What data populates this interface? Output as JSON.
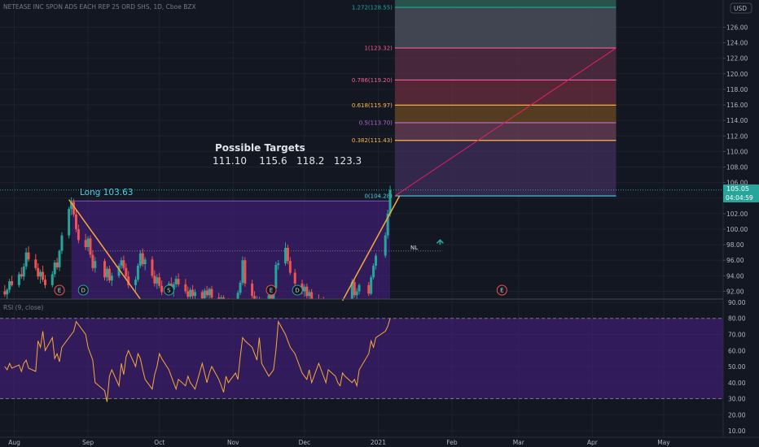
{
  "header": {
    "symbol_title": "NETEASE INC SPON ADS EACH REP 25 ORD SHS, 1D, Cboe BZX"
  },
  "price_axis": {
    "currency_label": "USD",
    "last_price": "105.05",
    "countdown": "04:04:59"
  },
  "annotations": {
    "long_entry": "Long 103.63",
    "targets_title": "Possible Targets",
    "targets_values": "111.10    115.6   118.2   123.3",
    "nl_label": "NL"
  },
  "fib_levels": [
    {
      "label": "1.272(128.55)",
      "price": 128.55,
      "color": "#26a69a"
    },
    {
      "label": "1(123.32)",
      "price": 123.32,
      "color": "#f06292"
    },
    {
      "label": "0.786(119.20)",
      "price": 119.2,
      "color": "#f06292"
    },
    {
      "label": "0.618(115.97)",
      "price": 115.97,
      "color": "#ffb74d"
    },
    {
      "label": "0.5(113.70)",
      "price": 113.7,
      "color": "#ba68c8"
    },
    {
      "label": "0.382(111.43)",
      "price": 111.43,
      "color": "#ffb74d"
    },
    {
      "label": "0(104.28)",
      "price": 104.28,
      "color": "#4dd0e1"
    }
  ],
  "events": [
    {
      "label": "E",
      "date": "2020-08-20"
    },
    {
      "label": "D",
      "date": "2020-08-30"
    },
    {
      "label": "S",
      "date": "2020-10-05"
    },
    {
      "label": "E",
      "date": "2020-11-17"
    },
    {
      "label": "D",
      "date": "2020-11-28"
    },
    {
      "label": "E",
      "date": "2021-02-22"
    }
  ],
  "rsi": {
    "title": "RSI (9, close)",
    "upper": 80,
    "lower": 30
  },
  "colors": {
    "up": "#26a69a",
    "down": "#ef5350",
    "rsi_line": "#f6a93b",
    "fib_line": "#e91e63"
  },
  "chart_data": {
    "type": "candlestick",
    "price_ylim": [
      91,
      129.5
    ],
    "price_ticks": [
      92,
      94,
      96,
      98,
      100,
      102,
      104,
      106,
      108,
      110,
      112,
      114,
      116,
      118,
      120,
      122,
      124,
      126
    ],
    "rsi_ylim": [
      6,
      92
    ],
    "rsi_ticks": [
      10,
      20,
      30,
      40,
      50,
      60,
      70,
      80,
      90
    ],
    "x_range": [
      "2020-07-26",
      "2021-05-26"
    ],
    "x_ticks": [
      {
        "label": "Aug",
        "date": "2020-08-01"
      },
      {
        "label": "Sep",
        "date": "2020-09-01"
      },
      {
        "label": "Oct",
        "date": "2020-10-01"
      },
      {
        "label": "Nov",
        "date": "2020-11-01"
      },
      {
        "label": "Dec",
        "date": "2020-12-01"
      },
      {
        "label": "2021",
        "date": "2021-01-01"
      },
      {
        "label": "Feb",
        "date": "2021-02-01"
      },
      {
        "label": "Mar",
        "date": "2021-03-01"
      },
      {
        "label": "Apr",
        "date": "2021-04-01"
      },
      {
        "label": "May",
        "date": "2021-05-01"
      }
    ],
    "candles": [
      [
        "2020-07-28",
        92.0,
        92.8,
        91.3,
        91.6
      ],
      [
        "2020-07-29",
        91.6,
        92.4,
        91.0,
        92.2
      ],
      [
        "2020-07-30",
        92.2,
        93.6,
        91.8,
        93.3
      ],
      [
        "2020-07-31",
        93.3,
        94.0,
        92.6,
        92.8
      ],
      [
        "2020-08-03",
        92.8,
        94.5,
        92.5,
        94.2
      ],
      [
        "2020-08-04",
        94.2,
        95.1,
        93.6,
        93.9
      ],
      [
        "2020-08-05",
        93.9,
        95.6,
        93.4,
        95.2
      ],
      [
        "2020-08-06",
        95.2,
        97.6,
        94.8,
        97.0
      ],
      [
        "2020-08-07",
        97.0,
        97.8,
        95.8,
        96.1
      ],
      [
        "2020-08-10",
        96.1,
        96.8,
        94.7,
        95.0
      ],
      [
        "2020-08-11",
        95.0,
        95.6,
        93.5,
        93.9
      ],
      [
        "2020-08-12",
        93.9,
        94.8,
        93.0,
        94.5
      ],
      [
        "2020-08-13",
        94.5,
        95.3,
        93.2,
        93.5
      ],
      [
        "2020-08-14",
        93.5,
        94.1,
        92.4,
        92.8
      ],
      [
        "2020-08-17",
        92.8,
        94.6,
        92.5,
        94.2
      ],
      [
        "2020-08-18",
        94.2,
        96.0,
        93.8,
        95.7
      ],
      [
        "2020-08-19",
        95.7,
        96.3,
        94.8,
        95.1
      ],
      [
        "2020-08-20",
        95.1,
        97.4,
        94.6,
        97.2
      ],
      [
        "2020-08-21",
        97.2,
        99.6,
        96.8,
        99.2
      ],
      [
        "2020-08-24",
        99.2,
        102.9,
        98.8,
        102.6
      ],
      [
        "2020-08-25",
        102.6,
        104.1,
        101.8,
        103.5
      ],
      [
        "2020-08-26",
        103.5,
        103.9,
        101.6,
        101.9
      ],
      [
        "2020-08-27",
        101.9,
        102.4,
        99.6,
        100.0
      ],
      [
        "2020-08-28",
        100.0,
        100.6,
        98.2,
        98.6
      ],
      [
        "2020-08-31",
        98.6,
        99.4,
        97.3,
        97.7
      ],
      [
        "2020-09-01",
        97.7,
        99.1,
        97.2,
        98.8
      ],
      [
        "2020-09-02",
        98.8,
        99.2,
        96.3,
        96.7
      ],
      [
        "2020-09-03",
        96.7,
        97.3,
        94.6,
        95.0
      ],
      [
        "2020-09-04",
        95.0,
        96.4,
        94.4,
        95.9
      ],
      [
        "2020-09-08",
        95.9,
        96.2,
        93.4,
        93.8
      ],
      [
        "2020-09-09",
        93.8,
        95.2,
        93.3,
        94.9
      ],
      [
        "2020-09-10",
        94.9,
        95.3,
        93.1,
        93.4
      ],
      [
        "2020-09-11",
        93.4,
        94.4,
        92.7,
        94.0
      ],
      [
        "2020-09-14",
        94.0,
        95.6,
        93.7,
        95.3
      ],
      [
        "2020-09-15",
        95.3,
        96.4,
        94.9,
        96.0
      ],
      [
        "2020-09-16",
        96.0,
        96.6,
        94.7,
        95.0
      ],
      [
        "2020-09-17",
        95.0,
        95.6,
        93.5,
        93.9
      ],
      [
        "2020-09-18",
        93.9,
        94.6,
        92.4,
        92.8
      ],
      [
        "2020-09-21",
        92.8,
        93.9,
        92.0,
        93.5
      ],
      [
        "2020-09-22",
        93.5,
        95.6,
        93.2,
        95.3
      ],
      [
        "2020-09-23",
        95.3,
        97.3,
        95.0,
        96.9
      ],
      [
        "2020-09-24",
        96.9,
        97.5,
        95.2,
        95.5
      ],
      [
        "2020-09-25",
        95.5,
        96.4,
        94.7,
        96.1
      ],
      [
        "2020-09-28",
        96.1,
        96.5,
        93.7,
        94.0
      ],
      [
        "2020-09-29",
        94.0,
        94.7,
        92.6,
        93.0
      ],
      [
        "2020-09-30",
        93.0,
        94.2,
        92.3,
        93.8
      ],
      [
        "2020-10-01",
        93.8,
        94.4,
        92.4,
        92.7
      ],
      [
        "2020-10-02",
        92.7,
        93.4,
        91.5,
        91.9
      ],
      [
        "2020-10-05",
        91.9,
        93.3,
        91.6,
        93.0
      ],
      [
        "2020-10-06",
        93.0,
        93.8,
        91.9,
        92.2
      ],
      [
        "2020-10-07",
        92.2,
        93.2,
        91.3,
        92.9
      ],
      [
        "2020-10-08",
        92.9,
        94.0,
        92.5,
        93.6
      ],
      [
        "2020-10-09",
        93.6,
        94.3,
        92.6,
        92.9
      ],
      [
        "2020-10-12",
        92.9,
        93.6,
        91.7,
        92.0
      ],
      [
        "2020-10-13",
        92.0,
        92.6,
        90.9,
        91.3
      ],
      [
        "2020-10-14",
        91.3,
        92.5,
        90.8,
        92.2
      ],
      [
        "2020-10-15",
        92.2,
        92.8,
        91.0,
        91.4
      ],
      [
        "2020-10-16",
        91.4,
        92.3,
        90.7,
        91.9
      ],
      [
        "2020-10-19",
        91.9,
        92.2,
        90.8,
        91.1
      ],
      [
        "2020-10-20",
        91.1,
        92.4,
        90.9,
        92.1
      ],
      [
        "2020-10-21",
        92.1,
        92.7,
        91.2,
        91.5
      ],
      [
        "2020-10-22",
        91.5,
        92.5,
        91.1,
        92.3
      ],
      [
        "2020-10-23",
        92.3,
        92.7,
        90.9,
        91.2
      ],
      [
        "2020-10-26",
        91.2,
        91.8,
        90.0,
        90.4
      ],
      [
        "2020-10-27",
        90.4,
        91.5,
        90.1,
        91.2
      ],
      [
        "2020-10-28",
        91.2,
        91.5,
        89.6,
        89.9
      ],
      [
        "2020-10-29",
        89.9,
        91.0,
        89.5,
        90.7
      ],
      [
        "2020-10-30",
        90.7,
        91.1,
        89.3,
        89.6
      ],
      [
        "2020-11-02",
        89.6,
        90.9,
        89.2,
        90.5
      ],
      [
        "2020-11-03",
        90.5,
        92.1,
        90.2,
        91.8
      ],
      [
        "2020-11-04",
        91.8,
        93.4,
        91.5,
        93.1
      ],
      [
        "2020-11-05",
        93.1,
        96.5,
        92.8,
        96.0
      ],
      [
        "2020-11-06",
        96.0,
        96.4,
        92.6,
        93.0
      ],
      [
        "2020-11-09",
        93.0,
        93.5,
        91.1,
        91.4
      ],
      [
        "2020-11-10",
        91.4,
        92.0,
        89.9,
        90.3
      ],
      [
        "2020-11-11",
        90.3,
        91.4,
        89.9,
        91.0
      ],
      [
        "2020-11-12",
        91.0,
        91.3,
        89.6,
        89.9
      ],
      [
        "2020-11-13",
        89.9,
        90.9,
        89.5,
        90.6
      ],
      [
        "2020-11-16",
        90.6,
        91.8,
        90.3,
        91.5
      ],
      [
        "2020-11-17",
        91.5,
        92.0,
        90.5,
        90.8
      ],
      [
        "2020-11-18",
        90.8,
        92.7,
        90.6,
        92.4
      ],
      [
        "2020-11-19",
        92.4,
        95.8,
        92.1,
        95.4
      ],
      [
        "2020-11-20",
        95.4,
        96.0,
        94.8,
        95.6
      ],
      [
        "2020-11-23",
        95.6,
        98.3,
        95.3,
        97.6
      ],
      [
        "2020-11-24",
        97.6,
        98.0,
        95.5,
        95.9
      ],
      [
        "2020-11-25",
        95.9,
        96.4,
        94.1,
        94.4
      ],
      [
        "2020-11-27",
        94.4,
        94.9,
        92.6,
        93.0
      ],
      [
        "2020-11-30",
        93.0,
        93.5,
        91.6,
        92.0
      ],
      [
        "2020-12-01",
        92.0,
        92.9,
        91.3,
        92.6
      ],
      [
        "2020-12-02",
        92.6,
        93.0,
        91.1,
        91.4
      ],
      [
        "2020-12-03",
        91.4,
        92.2,
        90.6,
        91.9
      ],
      [
        "2020-12-04",
        91.9,
        92.3,
        90.7,
        91.0
      ],
      [
        "2020-12-07",
        91.0,
        91.6,
        89.8,
        90.2
      ],
      [
        "2020-12-08",
        90.2,
        91.1,
        89.6,
        90.8
      ],
      [
        "2020-12-09",
        90.8,
        91.3,
        89.5,
        89.8
      ],
      [
        "2020-12-10",
        89.8,
        90.4,
        89.0,
        89.4
      ],
      [
        "2020-12-11",
        89.4,
        90.1,
        88.7,
        89.8
      ],
      [
        "2020-12-14",
        89.8,
        90.2,
        88.6,
        88.9
      ],
      [
        "2020-12-15",
        88.9,
        89.9,
        88.5,
        89.6
      ],
      [
        "2020-12-16",
        89.6,
        90.0,
        88.4,
        88.7
      ],
      [
        "2020-12-17",
        88.7,
        89.6,
        88.3,
        89.2
      ],
      [
        "2020-12-18",
        89.2,
        89.5,
        88.2,
        88.5
      ],
      [
        "2020-12-21",
        88.5,
        93.6,
        88.3,
        93.2
      ],
      [
        "2020-12-22",
        93.2,
        93.6,
        91.2,
        91.5
      ],
      [
        "2020-12-23",
        91.5,
        92.4,
        90.8,
        92.0
      ],
      [
        "2020-12-24",
        92.0,
        93.0,
        91.6,
        92.8
      ],
      [
        "2020-12-28",
        92.8,
        93.2,
        91.4,
        91.7
      ],
      [
        "2020-12-29",
        91.7,
        94.1,
        91.5,
        93.8
      ],
      [
        "2020-12-30",
        93.8,
        95.6,
        93.5,
        95.3
      ],
      [
        "2020-12-31",
        95.3,
        96.9,
        94.8,
        96.6
      ],
      [
        "2021-01-04",
        96.6,
        99.6,
        96.3,
        99.2
      ],
      [
        "2021-01-05",
        99.2,
        102.5,
        98.8,
        102.0
      ],
      [
        "2021-01-06",
        102.0,
        105.6,
        101.6,
        105.05
      ]
    ],
    "rsi_values": [
      50,
      48,
      52,
      49,
      51,
      47,
      52,
      54,
      49,
      47,
      66,
      62,
      72,
      60,
      68,
      55,
      58,
      53,
      62,
      70,
      72,
      78,
      76,
      70,
      62,
      58,
      54,
      40,
      35,
      28,
      44,
      48,
      38,
      52,
      45,
      56,
      60,
      50,
      58,
      55,
      48,
      42,
      36,
      45,
      50,
      58,
      55,
      48,
      44,
      40,
      36,
      42,
      38,
      44,
      40,
      36,
      52,
      46,
      40,
      46,
      50,
      42,
      38,
      34,
      44,
      40,
      46,
      42,
      56,
      68,
      66,
      62,
      58,
      54,
      68,
      52,
      44,
      46,
      48,
      60,
      78,
      70,
      66,
      62,
      58,
      46,
      44,
      42,
      48,
      40,
      52,
      44,
      40,
      48,
      44,
      40,
      38,
      46,
      44,
      40,
      42,
      38,
      48,
      58,
      66,
      62,
      68,
      72,
      75,
      80
    ]
  }
}
